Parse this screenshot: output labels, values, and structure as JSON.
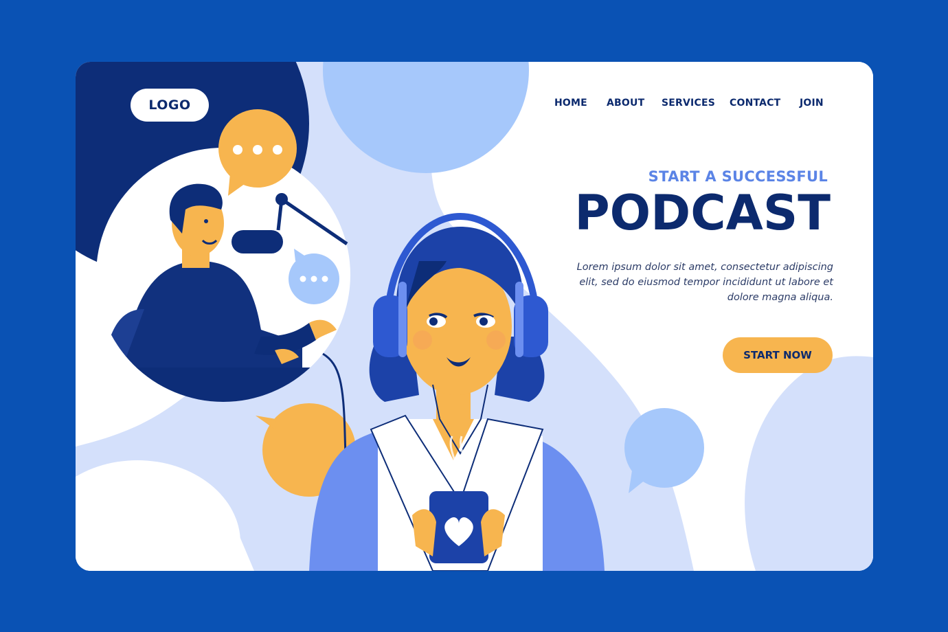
{
  "brand": {
    "logo_label": "LOGO"
  },
  "nav": {
    "items": [
      {
        "label": "HOME"
      },
      {
        "label": "ABOUT"
      },
      {
        "label": "SERVICES"
      },
      {
        "label": "CONTACT"
      },
      {
        "label": "JOIN"
      }
    ]
  },
  "hero": {
    "tagline": "START A SUCCESSFUL",
    "headline": "PODCAST",
    "body": "Lorem ipsum dolor sit amet, consectetur adipiscing elit, sed do eiusmod tempor incididunt ut labore et dolore magna aliqua.",
    "cta_label": "START NOW"
  },
  "colors": {
    "page_background": "#0a52b4",
    "navy": "#0c2a6e",
    "accent_blue": "#5b84e6",
    "light_blue": "#a6c8fb",
    "pale_blue": "#d4e0fb",
    "yellow": "#f7b54f"
  },
  "illustration": {
    "icons": [
      "speech-bubble-icon",
      "microphone-icon",
      "headphones-icon",
      "heart-mug-icon"
    ]
  }
}
